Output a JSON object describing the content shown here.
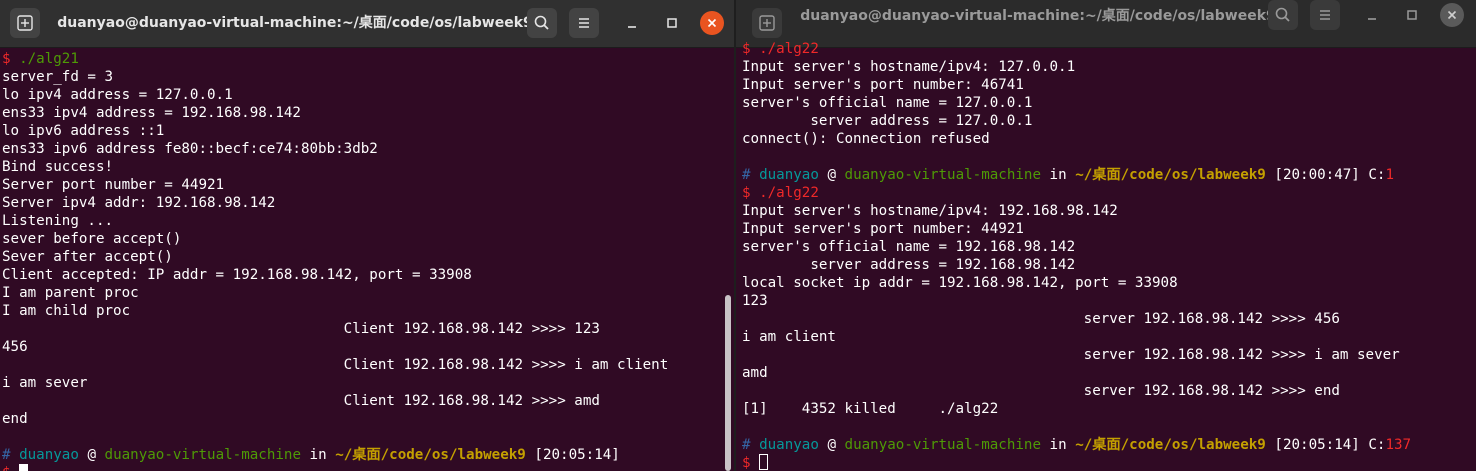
{
  "left": {
    "title": "duanyao@duanyao-virtual-machine:~/桌面/code/os/labweek9",
    "command": "./alg21",
    "output": [
      "server_fd = 3",
      "lo ipv4 address = 127.0.0.1",
      "ens33 ipv4 address = 192.168.98.142",
      "lo ipv6 address ::1",
      "ens33 ipv6 address fe80::becf:ce74:80bb:3db2",
      "Bind success!",
      "Server port number = 44921",
      "Server ipv4 addr: 192.168.98.142",
      "Listening ...",
      "sever before accept()",
      "Sever after accept()",
      "Client accepted: IP addr = 192.168.98.142, port = 33908",
      "I am parent proc",
      "I am child proc",
      "                                        Client 192.168.98.142 >>>> 123",
      "456",
      "                                        Client 192.168.98.142 >>>> i am client",
      "i am sever",
      "                                        Client 192.168.98.142 >>>> amd",
      "end",
      ""
    ],
    "prompt": {
      "user": "duanyao",
      "at": "@",
      "host": "duanyao-virtual-machine",
      "in": "in",
      "path": "~/桌面/code/os/labweek9",
      "time": "[20:05:14]"
    }
  },
  "right": {
    "title": "duanyao@duanyao-virtual-machine:~/桌面/code/os/labweek9",
    "command1": "./alg22",
    "output1": [
      "Input server's hostname/ipv4: 127.0.0.1",
      "Input server's port number: 46741",
      "server's official name = 127.0.0.1",
      "        server address = 127.0.0.1",
      "connect(): Connection refused",
      ""
    ],
    "prompt1": {
      "user": "duanyao",
      "at": "@",
      "host": "duanyao-virtual-machine",
      "in": "in",
      "path": "~/桌面/code/os/labweek9",
      "time": "[20:00:47]",
      "code_label": "C:",
      "code": "1"
    },
    "command2": "./alg22",
    "output2": [
      "Input server's hostname/ipv4: 192.168.98.142",
      "Input server's port number: 44921",
      "server's official name = 192.168.98.142",
      "        server address = 192.168.98.142",
      "local socket ip addr = 192.168.98.142, port = 33908",
      "123",
      "                                        server 192.168.98.142 >>>> 456",
      "i am client",
      "                                        server 192.168.98.142 >>>> i am sever",
      "amd",
      "                                        server 192.168.98.142 >>>> end",
      "[1]    4352 killed     ./alg22",
      ""
    ],
    "prompt2": {
      "user": "duanyao",
      "at": "@",
      "host": "duanyao-virtual-machine",
      "in": "in",
      "path": "~/桌面/code/os/labweek9",
      "time": "[20:05:14]",
      "code_label": "C:",
      "code": "137"
    }
  },
  "symbols": {
    "dollar": "$",
    "hash": "#"
  },
  "colors": {
    "terminal_bg": "#300a24",
    "prompt_red": "#ef2929",
    "prompt_cyan": "#06989a",
    "prompt_green": "#4e9a06",
    "prompt_yellow": "#c4a000",
    "close_orange": "#e95420"
  },
  "icons": [
    "new-tab-icon",
    "search-icon",
    "hamburger-menu-icon",
    "minimize-icon",
    "maximize-icon",
    "close-icon"
  ]
}
